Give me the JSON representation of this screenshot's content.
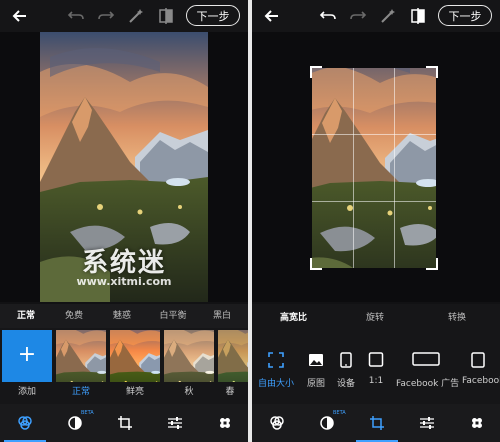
{
  "left_screen": {
    "topbar": {
      "back_icon": "arrow-left-icon",
      "undo_icon": "undo-icon",
      "redo_icon": "redo-icon",
      "auto_fix_icon": "magic-wand-icon",
      "compare_icon": "compare-icon",
      "next_label": "下一步"
    },
    "filter_tabs": [
      "正常",
      "免费",
      "魅惑",
      "白平衡",
      "黑白"
    ],
    "active_filter_tab": 0,
    "filters": [
      {
        "label": "添加",
        "icon": "plus-icon"
      },
      {
        "label": "正常"
      },
      {
        "label": "鲜亮"
      },
      {
        "label": "秋"
      },
      {
        "label": "春"
      }
    ],
    "selected_filter": 1,
    "watermark": {
      "main": "系统迷",
      "url": "www.xitmi.com"
    }
  },
  "right_screen": {
    "topbar": {
      "back_icon": "arrow-left-icon",
      "undo_icon": "undo-icon",
      "redo_icon": "redo-icon",
      "auto_fix_icon": "magic-wand-icon",
      "compare_icon": "compare-icon",
      "next_label": "下一步"
    },
    "crop_tabs": [
      "高宽比",
      "旋转",
      "转换"
    ],
    "active_crop_tab": 0,
    "aspect_options": [
      {
        "label": "自由大小",
        "icon": "free-crop-icon"
      },
      {
        "label": "原图",
        "icon": "image-icon"
      },
      {
        "label": "设备",
        "icon": "phone-icon"
      },
      {
        "label": "1:1",
        "icon": "square-icon"
      },
      {
        "label": "Facebook 广告",
        "icon": "wide-rect-icon"
      },
      {
        "label": "Facebook",
        "icon": "rect-icon"
      }
    ],
    "selected_aspect": 0
  },
  "bottom_nav": [
    {
      "name": "looks",
      "icon": "looks-icon"
    },
    {
      "name": "healing",
      "icon": "healing-icon",
      "badge": "BETA"
    },
    {
      "name": "crop",
      "icon": "crop-icon"
    },
    {
      "name": "adjustments",
      "icon": "sliders-icon"
    },
    {
      "name": "bandage",
      "icon": "bandage-icon"
    }
  ],
  "colors": {
    "accent": "#3ea0ff",
    "add_tile": "#1e88e5",
    "background": "#121214"
  }
}
